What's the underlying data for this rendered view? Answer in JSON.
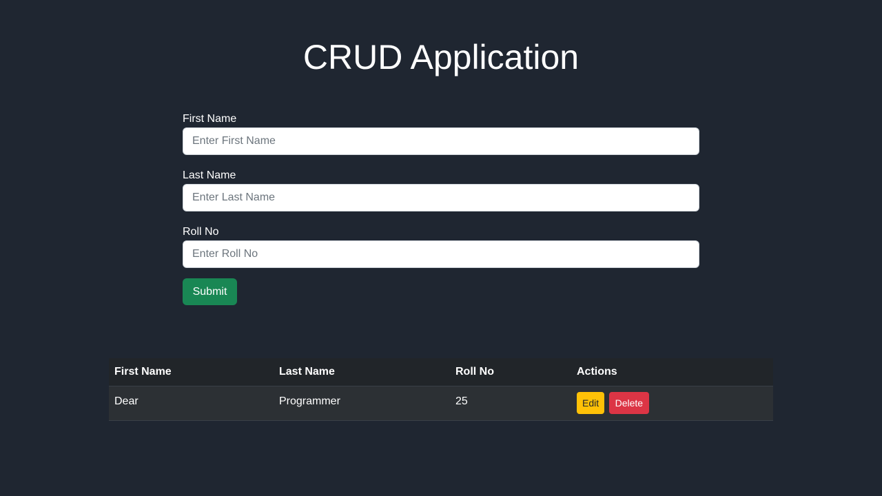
{
  "page": {
    "title": "CRUD Application"
  },
  "form": {
    "fields": [
      {
        "label": "First Name",
        "placeholder": "Enter First Name",
        "value": ""
      },
      {
        "label": "Last Name",
        "placeholder": "Enter Last Name",
        "value": ""
      },
      {
        "label": "Roll No",
        "placeholder": "Enter Roll No",
        "value": ""
      }
    ],
    "submit_label": "Submit"
  },
  "table": {
    "headers": [
      "First Name",
      "Last Name",
      "Roll No",
      "Actions"
    ],
    "rows": [
      {
        "first_name": "Dear",
        "last_name": "Programmer",
        "roll_no": "25",
        "edit_label": "Edit",
        "delete_label": "Delete"
      }
    ]
  },
  "colors": {
    "background": "#1f2631",
    "submit": "#198754",
    "edit": "#ffc107",
    "delete": "#dc3545"
  }
}
